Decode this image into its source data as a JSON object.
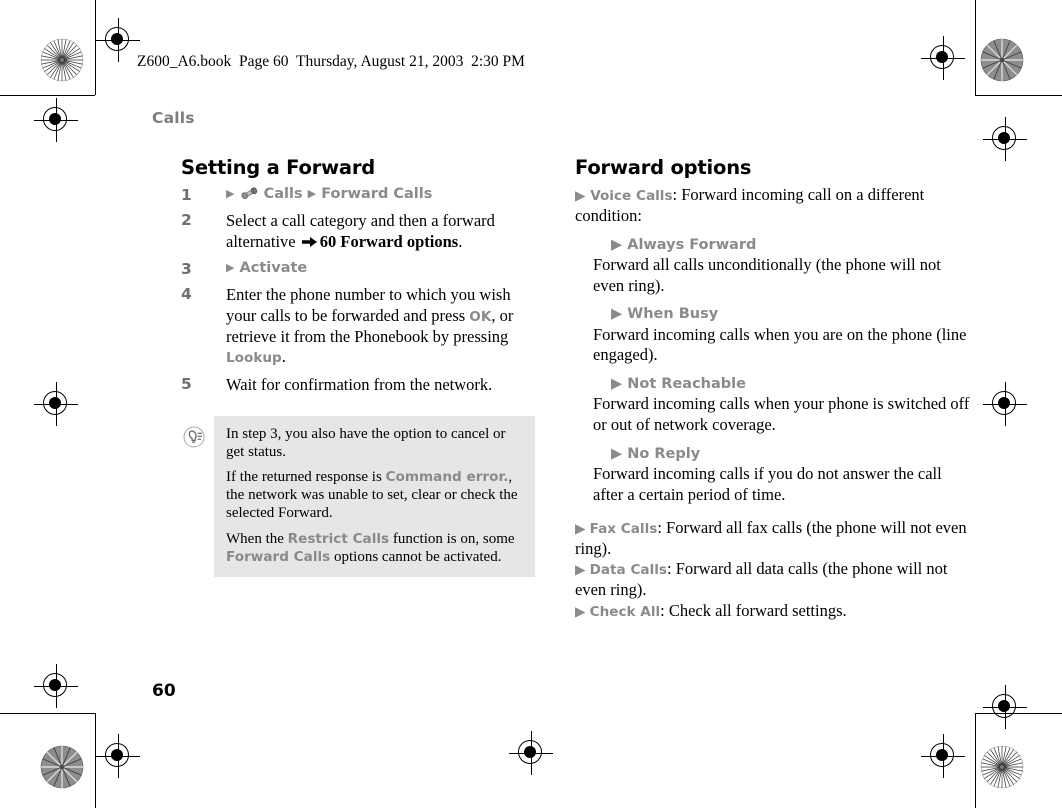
{
  "print_marks": {
    "file_line": "Z600_A6.book  Page 60  Thursday, August 21, 2003  2:30 PM"
  },
  "page": {
    "running_head": "Calls",
    "page_number": "60"
  },
  "left_column": {
    "heading": "Setting a Forward",
    "steps": [
      {
        "number": "1",
        "type": "menu",
        "icon": "handset-icon",
        "arrow_1": "▶",
        "label_1": "Calls",
        "arrow_2": "▶",
        "label_2": "Forward Calls"
      },
      {
        "number": "2",
        "type": "text",
        "text_before": "Select a call category and then a forward alternative ",
        "xref": "60 Forward options",
        "text_after": "."
      },
      {
        "number": "3",
        "type": "menu",
        "arrow_1": "▶",
        "label_1": "Activate"
      },
      {
        "number": "4",
        "type": "text",
        "parts": [
          {
            "t": "Enter the phone number to which you wish your calls to be forwarded and press ",
            "ui": false
          },
          {
            "t": "OK",
            "ui": true
          },
          {
            "t": ", or retrieve it from the Phonebook by pressing ",
            "ui": false
          },
          {
            "t": "Lookup",
            "ui": true
          },
          {
            "t": ".",
            "ui": false
          }
        ]
      },
      {
        "number": "5",
        "type": "text",
        "text_before": "Wait for confirmation from the network.",
        "xref": "",
        "text_after": ""
      }
    ],
    "note": {
      "icon": "tip-bulb-icon",
      "paragraphs": [
        [
          {
            "t": "In step 3, you also have the option to cancel or get status.",
            "ui": false
          }
        ],
        [
          {
            "t": "If the returned response is ",
            "ui": false
          },
          {
            "t": "Command error.",
            "ui": true
          },
          {
            "t": ", the network was unable to set, clear or check the selected Forward.",
            "ui": false
          }
        ],
        [
          {
            "t": "When the ",
            "ui": false
          },
          {
            "t": "Restrict Calls",
            "ui": true
          },
          {
            "t": " function is on, some ",
            "ui": false
          },
          {
            "t": "Forward Calls",
            "ui": true
          },
          {
            "t": " options cannot be activated.",
            "ui": false
          }
        ]
      ]
    }
  },
  "right_column": {
    "heading": "Forward options",
    "intro": [
      {
        "t": "▶ ",
        "ui": true
      },
      {
        "t": "Voice Calls",
        "ui": true
      },
      {
        "t": ": Forward incoming call on a different condition:",
        "ui": false
      }
    ],
    "conditions": [
      {
        "arrow": "▶",
        "name": "Always Forward",
        "description": "Forward all calls unconditionally (the phone will not even ring)."
      },
      {
        "arrow": "▶",
        "name": "When Busy",
        "description": "Forward incoming calls when you are on the phone (line engaged)."
      },
      {
        "arrow": "▶",
        "name": "Not Reachable",
        "description": "Forward incoming calls when your phone is switched off or out of network coverage."
      },
      {
        "arrow": "▶",
        "name": "No Reply",
        "description": "Forward incoming calls if you do not answer the call after a certain period of time."
      }
    ],
    "tail_options": [
      {
        "arrow": "▶",
        "name": "Fax Calls",
        "description": ": Forward all fax calls (the phone will not even ring)."
      },
      {
        "arrow": "▶",
        "name": "Data Calls",
        "description": ": Forward all data calls (the phone will not even ring)."
      },
      {
        "arrow": "▶",
        "name": "Check All",
        "description": ": Check all forward settings."
      }
    ]
  },
  "colors": {
    "ui_term_gray": "#8a8a8a",
    "running_head_gray": "#7d7d7d",
    "note_background": "#e6e6e6",
    "body_black": "#000000"
  }
}
